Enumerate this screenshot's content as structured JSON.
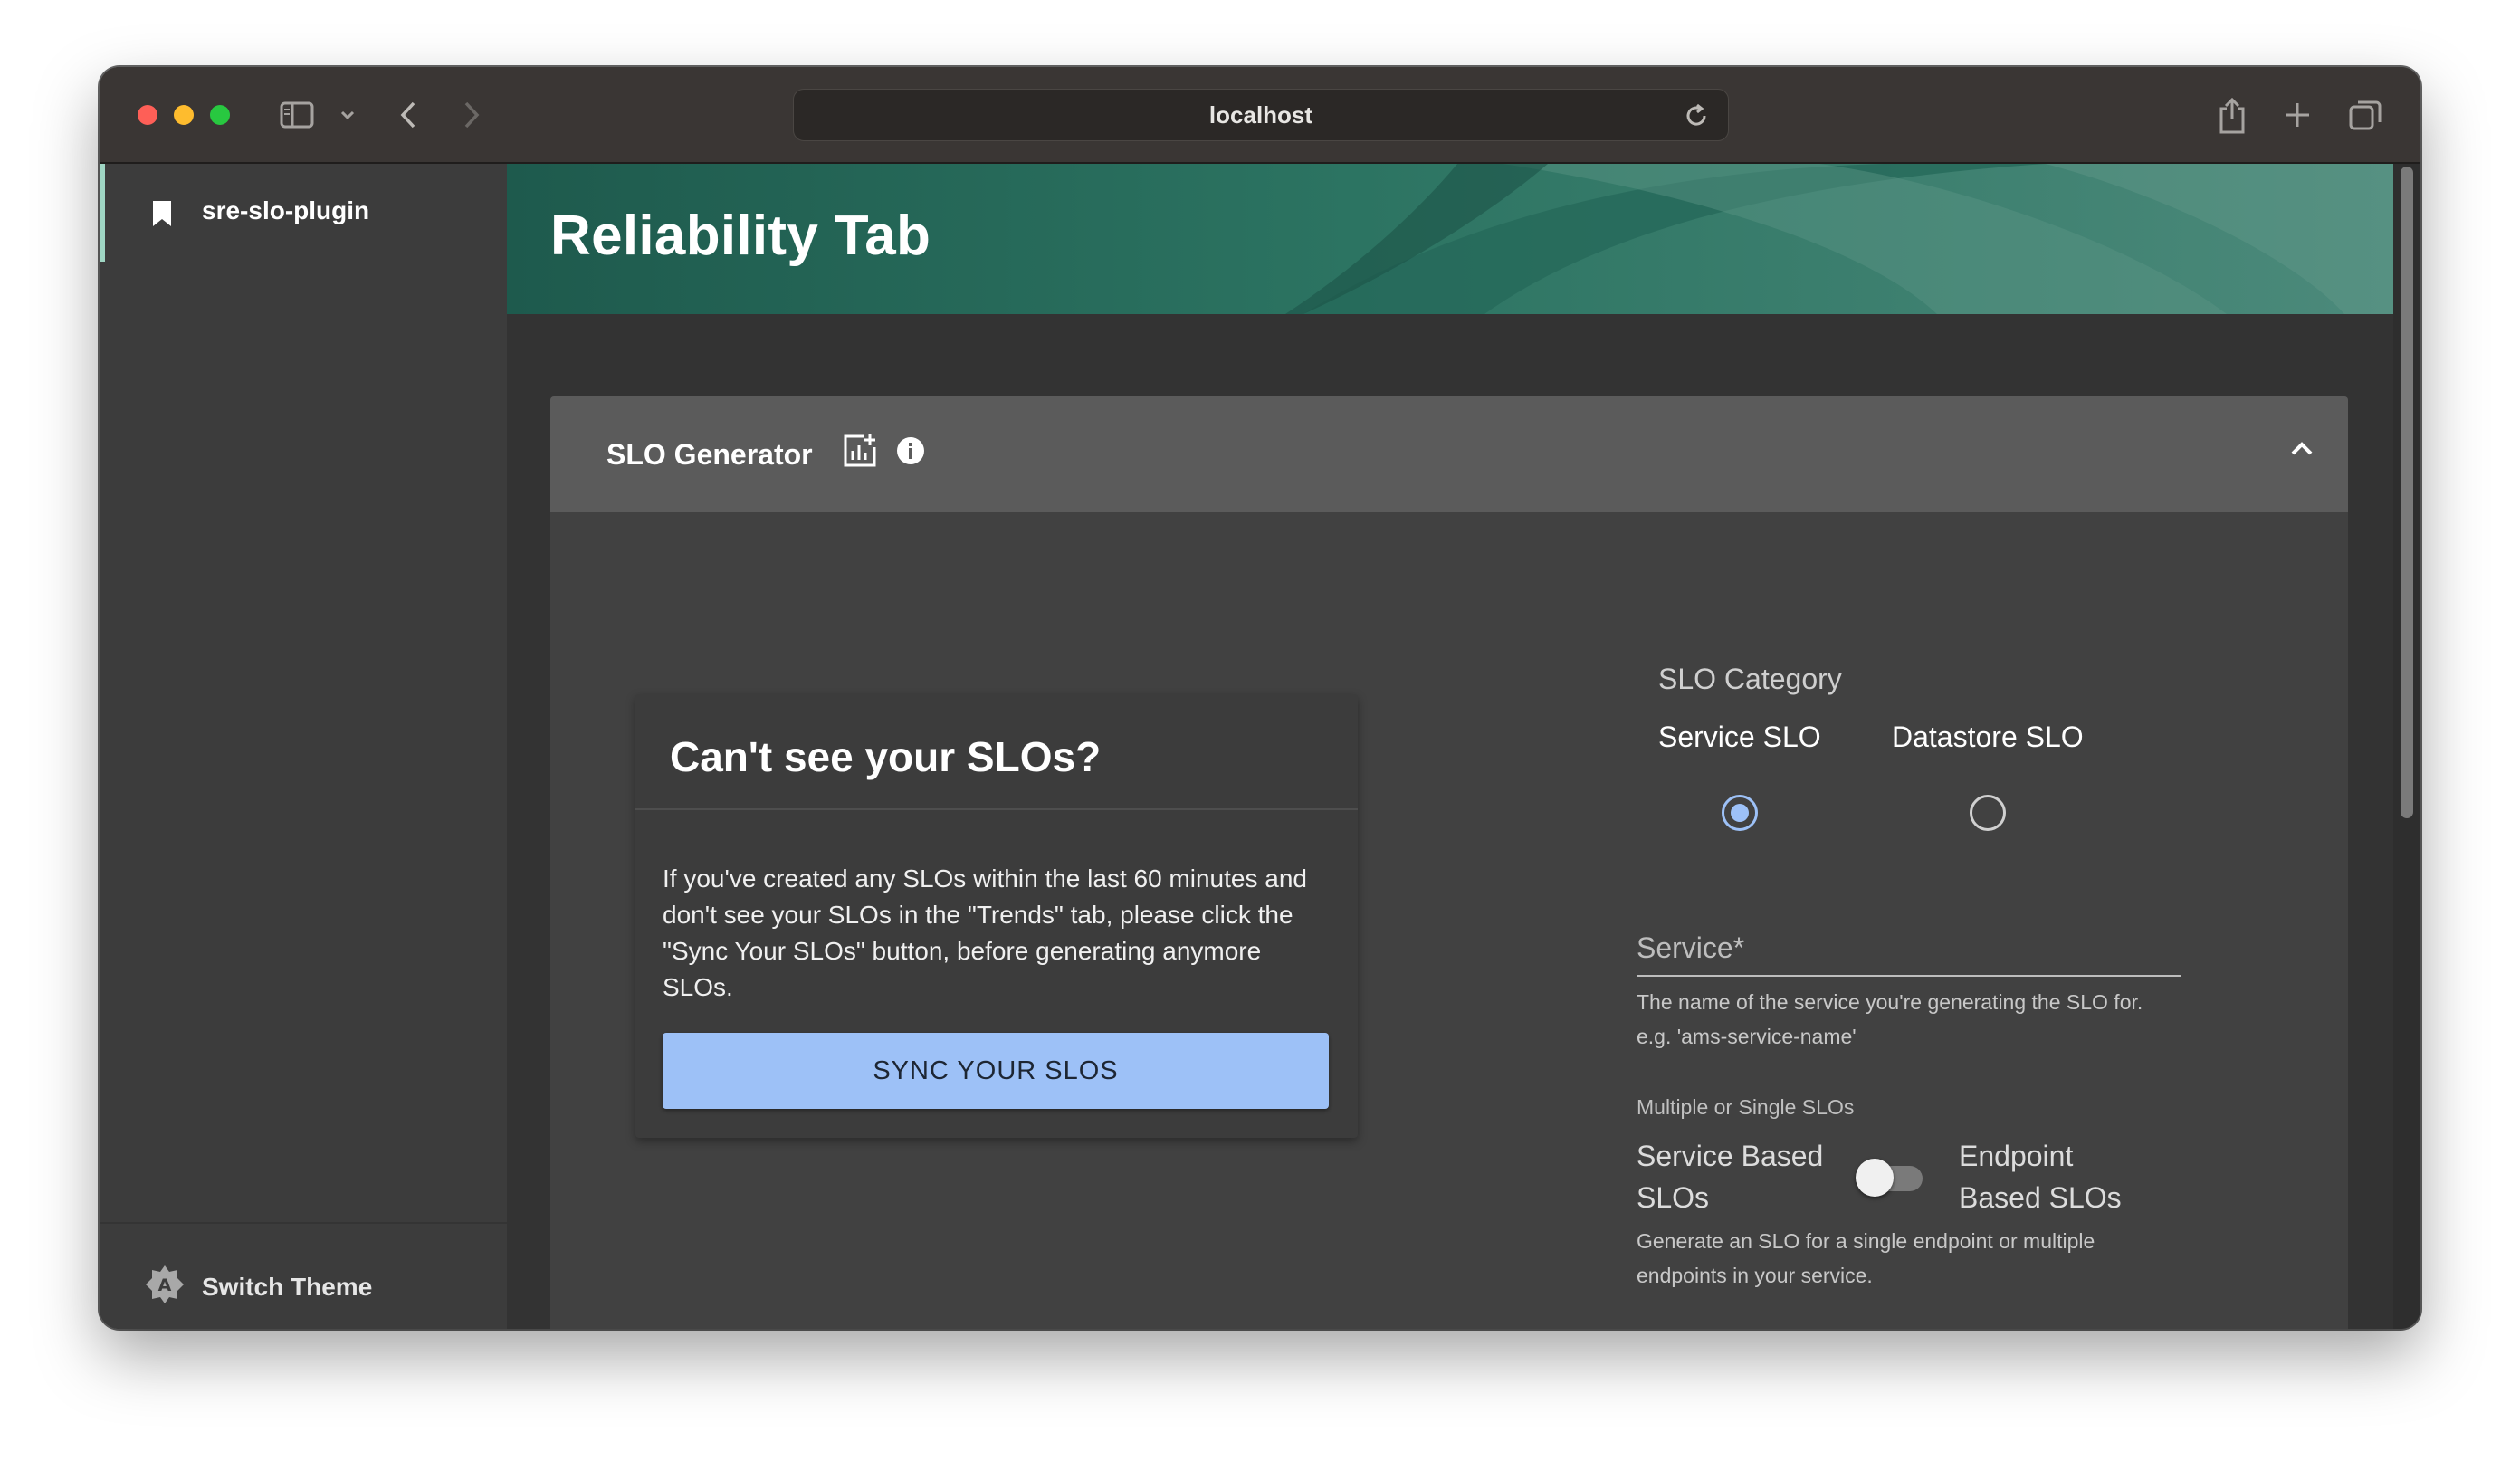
{
  "browser": {
    "url": "localhost"
  },
  "sidebar": {
    "plugin_label": "sre-slo-plugin",
    "switch_theme_label": "Switch Theme"
  },
  "header": {
    "title": "Reliability Tab"
  },
  "accordion": {
    "title": "SLO Generator"
  },
  "info_card": {
    "title": "Can't see your SLOs?",
    "body": "If you've created any SLOs within the last 60 minutes and don't see your SLOs in the \"Trends\" tab, please click the \"Sync Your SLOs\" button, before generating anymore SLOs.",
    "button_label": "SYNC YOUR SLOS"
  },
  "form": {
    "category_label": "SLO Category",
    "options": [
      {
        "label": "Service SLO",
        "checked": true
      },
      {
        "label": "Datastore SLO",
        "checked": false
      }
    ],
    "service_label": "Service*",
    "service_value": "",
    "service_helper_1": "The name of the service you're generating the SLO for.",
    "service_helper_2": "e.g. 'ams-service-name'",
    "multi_label": "Multiple or Single SLOs",
    "toggle_left_1": "Service Based",
    "toggle_left_2": "SLOs",
    "toggle_right_1": "Endpoint",
    "toggle_right_2": "Based SLOs",
    "toggle_on": false,
    "toggle_helper_1": "Generate an SLO for a single endpoint or multiple",
    "toggle_helper_2": "endpoints in your service."
  },
  "colors": {
    "accent": "#9dc1f7",
    "header_green": "#2c7462",
    "sidebar_active": "#9fd6c3"
  }
}
